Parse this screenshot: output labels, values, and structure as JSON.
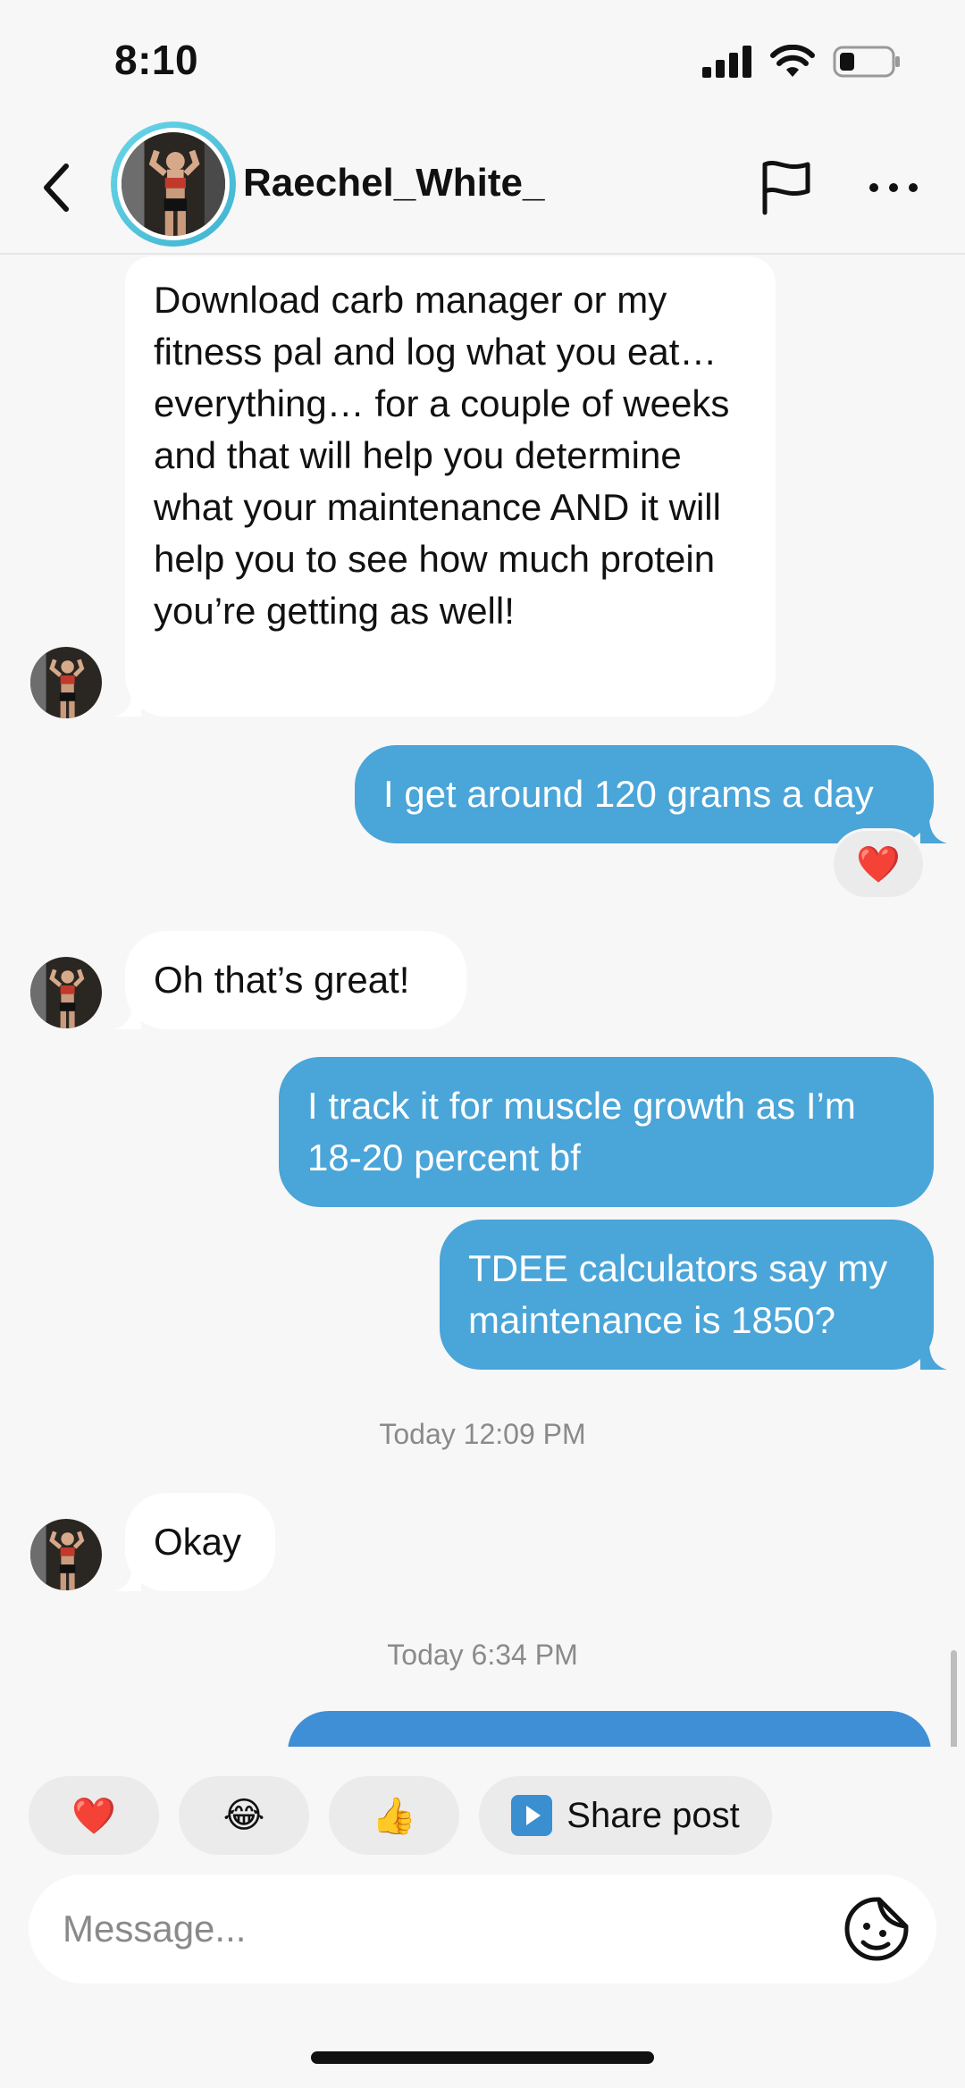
{
  "status_bar": {
    "time": "8:10"
  },
  "header": {
    "name": "Raechel_White_"
  },
  "messages": [
    {
      "text": "Download carb manager or my fitness pal and log what you eat… everything… for a couple of weeks and that will help you determine what your maintenance AND it will help you to see how much protein you’re getting as well!"
    },
    {
      "text": "I get around 120 grams a day",
      "reaction": "❤️"
    },
    {
      "text": "Oh that’s great!"
    },
    {
      "text": "I track it for muscle growth as I’m 18-20 percent bf"
    },
    {
      "text": "TDEE calculators say my maintenance is 1850?"
    },
    {
      "text": "Okay"
    }
  ],
  "timestamps": [
    "Today 12:09 PM",
    "Today 6:34 PM"
  ],
  "quick_replies": {
    "heart": "❤️",
    "laugh": "😂",
    "thumbs": "👍",
    "share_label": "Share post"
  },
  "composer": {
    "placeholder": "Message..."
  },
  "colors": {
    "outgoing": "#4aa5d8",
    "incoming": "#ffffff",
    "background": "#f7f7f7",
    "accent_ring": "#3fb3d0"
  },
  "icons": [
    "back-icon",
    "flag-icon",
    "more-icon",
    "heart-icon",
    "laugh-emoji-icon",
    "thumbs-up-icon",
    "play-icon",
    "sticker-icon",
    "signal-icon",
    "wifi-icon",
    "battery-icon"
  ]
}
